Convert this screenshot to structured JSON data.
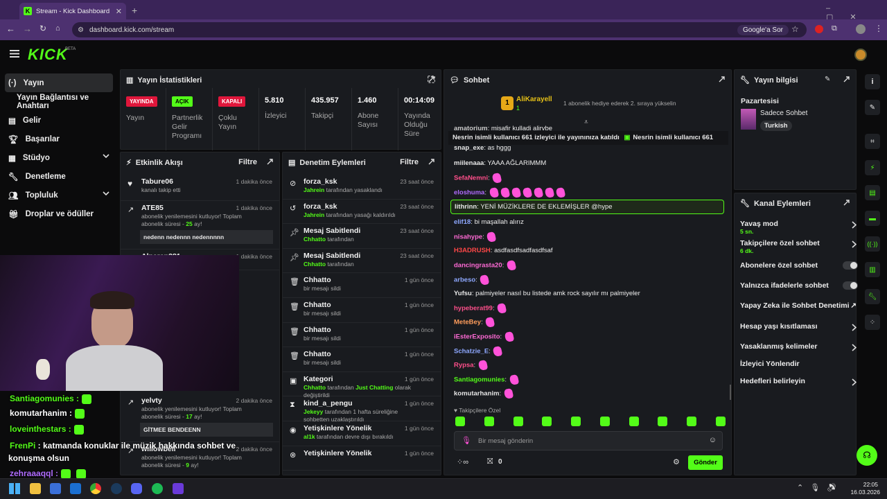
{
  "browser": {
    "tab_title": "Stream - Kick Dashboard",
    "url": "dashboard.kick.com/stream",
    "google_pill": "Google'a Sor"
  },
  "kick": {
    "logo": "KICK",
    "beta": "BETA"
  },
  "sidebar": {
    "items": [
      {
        "label": "Yayın",
        "icon": "broadcast-icon"
      },
      {
        "label": "Yayın Bağlantısı ve Anahtarı"
      },
      {
        "label": "Gelir",
        "icon": "chart-icon"
      },
      {
        "label": "Başarılar",
        "icon": "trophy-icon"
      },
      {
        "label": "Stüdyo",
        "icon": "studio-icon"
      },
      {
        "label": "Denetleme",
        "icon": "wrench-icon"
      },
      {
        "label": "Topluluk",
        "icon": "community-icon"
      },
      {
        "label": "Droplar ve ödüller",
        "icon": "gift-icon"
      }
    ]
  },
  "stats": {
    "title": "Yayın İstatistikleri",
    "items": [
      {
        "badge": "YAYINDA",
        "label": "Yayın",
        "color": "#e0163b"
      },
      {
        "badge": "AÇIK",
        "label": "Partnerlik Gelir Programı",
        "color": "#53fc18"
      },
      {
        "badge": "KAPALI",
        "label": "Çoklu Yayın",
        "color": "#e0163b"
      },
      {
        "value": "5.810",
        "label": "İzleyici"
      },
      {
        "value": "435.957",
        "label": "Takipçi"
      },
      {
        "value": "1.460",
        "label": "Abone Sayısı"
      },
      {
        "value": "00:14:09",
        "label": "Yayında Olduğu Süre"
      }
    ]
  },
  "activity": {
    "title": "Etkinlik Akışı",
    "filter": "Filtre",
    "rows": [
      {
        "user": "Tabure06",
        "text": "kanalı takip etti",
        "time": "1 dakika önce"
      },
      {
        "user": "ATE85",
        "text": "abonelik yenilemesini kutluyor! Toplam abonelik süresi - ",
        "months": "25",
        "suffix": " ay!",
        "time": "1 dakika önce",
        "msg": "nedenn nedennn nedennnnn"
      },
      {
        "user": "Alperen381",
        "time": "1 dakika önce"
      },
      {
        "user": "yelvty",
        "text": "abonelik yenilemesini kutluyor! Toplam abonelik süresi - ",
        "months": "17",
        "suffix": " ay!",
        "time": "2 dakika önce",
        "msg": "GİTMEE BENDEENN"
      },
      {
        "user": "willowbell",
        "text": "abonelik yenilemesini kutluyor! Toplam abonelik süresi - ",
        "months": "9",
        "suffix": " ay!",
        "time": "2 dakika önce"
      }
    ]
  },
  "moderation": {
    "title": "Denetim Eylemleri",
    "filter": "Filtre",
    "rows": [
      {
        "title": "forza_ksk",
        "actor": "Jahrein",
        "text": " tarafından yasaklandı",
        "time": "23 saat önce",
        "icon": "ban-icon"
      },
      {
        "title": "forza_ksk",
        "actor": "Jahrein",
        "text": " tarafından yasağı kaldırıldı",
        "time": "23 saat önce",
        "icon": "undo-icon"
      },
      {
        "title": "Mesaj Sabitlendi",
        "actor": "Chhatto",
        "text": " tarafından",
        "time": "23 saat önce",
        "icon": "pin-icon"
      },
      {
        "title": "Mesaj Sabitlendi",
        "actor": "Chhatto",
        "text": " tarafından",
        "time": "23 saat önce",
        "icon": "pin-icon"
      },
      {
        "title": "Chhatto",
        "actor": "",
        "text": "bir mesajı sildi",
        "time": "1 gün önce",
        "icon": "trash-icon"
      },
      {
        "title": "Chhatto",
        "actor": "",
        "text": "bir mesajı sildi",
        "time": "1 gün önce",
        "icon": "trash-icon"
      },
      {
        "title": "Chhatto",
        "actor": "",
        "text": "bir mesajı sildi",
        "time": "1 gün önce",
        "icon": "trash-icon"
      },
      {
        "title": "Chhatto",
        "actor": "",
        "text": "bir mesajı sildi",
        "time": "1 gün önce",
        "icon": "trash-icon"
      },
      {
        "title": "Kategori",
        "actor": "Chhatto",
        "text": " tarafından ",
        "extra": "Just Chatting",
        "text2": " olarak değiştirildi",
        "time": "1 gün önce",
        "icon": "category-icon"
      },
      {
        "title": "kind_a_pengu",
        "actor": "Jekeyy",
        "text": " tarafından 1 hafta süreliğine sohbetten uzaklaştırıldı",
        "time": "1 gün önce",
        "icon": "hourglass-icon"
      },
      {
        "title": "Yetişkinlere Yönelik",
        "actor": "al1k",
        "text": " tarafından devre dışı bırakıldı",
        "time": "1 gün önce",
        "icon": "eye-icon"
      },
      {
        "title": "Yetişkinlere Yönelik",
        "actor": "",
        "text": "",
        "time": "1 gün önce",
        "icon": "eye-off-icon"
      }
    ]
  },
  "chat": {
    "title": "Sohbet",
    "top_gifter": "AliKarayell",
    "top_gifter_count": "1",
    "gift_hint": "1 abonelik hediye ederek 2. sıraya yükselin",
    "ticker": [
      "Nesrin isimli kullanıcı ",
      "661",
      " izleyici ile yayınınıza katıldı",
      "Nesrin isimli kullanıcı ",
      "661"
    ],
    "lines": [
      {
        "user": "amatorium",
        "color": "#c8c8c8",
        "text": "misafir kulladi alirvbe"
      },
      {
        "user": "snap_exe",
        "color": "#e8e8e8",
        "text": "as hggg"
      },
      {
        "user": "miilenaaa",
        "color": "#e8e8e8",
        "text": "YAAA AĞLARIMMM"
      },
      {
        "user": "SefaNemni",
        "color": "#ff4f8b",
        "text": ""
      },
      {
        "user": "eloshuma",
        "color": "#b06cff",
        "text": ""
      },
      {
        "user": "lithrinn",
        "color": "#e8e8e8",
        "text": "YENİ MÜZİKLERE DE EKLEMİŞLER @hype"
      },
      {
        "user": "elif18",
        "color": "#8ea8ff",
        "text": "bi maşallah alırız"
      },
      {
        "user": "nisahype",
        "color": "#ff6ad5",
        "text": ""
      },
      {
        "user": "H3ADRUSH",
        "color": "#ff4747",
        "text": "asdfasdfsadfasdfsaf"
      },
      {
        "user": "dancingrasta20",
        "color": "#ff6ad5",
        "text": ""
      },
      {
        "user": "arbeso",
        "color": "#8ea8ff",
        "text": ""
      },
      {
        "user": "Yufsu",
        "color": "#e8e8e8",
        "text": "palmiyeler nasıl bu listede amk rock sayılır mı palmiyeler"
      },
      {
        "user": "hypeberat99",
        "color": "#ff4f8b",
        "text": ""
      },
      {
        "user": "MeteBey",
        "color": "#ff9d5c",
        "text": ""
      },
      {
        "user": "iEsterExposito",
        "color": "#ff6ad5",
        "text": ""
      },
      {
        "user": "Schatzie_E",
        "color": "#8ea8ff",
        "text": ""
      },
      {
        "user": "Rypsa",
        "color": "#ff4f8b",
        "text": ""
      },
      {
        "user": "Santiagomunies",
        "color": "#53fc18",
        "text": ""
      },
      {
        "user": "komutarhanim",
        "color": "#e8e8e8",
        "text": ""
      }
    ],
    "followers_only": "Takipçilere Özel",
    "input_placeholder": "Bir mesaj gönderin",
    "points": "0",
    "send": "Gönder"
  },
  "info": {
    "title": "Yayın bilgisi",
    "day": "Pazartesisi",
    "stream_title": "Sadece Sohbet",
    "tag": "Turkish"
  },
  "channel": {
    "title": "Kanal Eylemleri",
    "items": [
      {
        "label": "Yavaş mod",
        "sub": "5 sn.",
        "type": "chevron"
      },
      {
        "label": "Takipçilere özel sohbet",
        "sub": "6 dk.",
        "type": "chevron"
      },
      {
        "label": "Abonelere özel sohbet",
        "type": "toggle"
      },
      {
        "label": "Yalnızca ifadelerle sohbet",
        "type": "toggle"
      },
      {
        "label": "Yapay Zeka ile Sohbet Denetimi",
        "type": "external"
      },
      {
        "label": "Hesap yaşı kısıtlaması",
        "type": "chevron"
      },
      {
        "label": "Yasaklanmış kelimeler",
        "type": "chevron"
      },
      {
        "label": "İzleyici Yönlendir",
        "type": "none"
      },
      {
        "label": "Hedefleri belirleyin",
        "type": "chevron"
      }
    ]
  },
  "overlay": {
    "lines": [
      {
        "user": "Santiagomunies :",
        "color": "#53fc18"
      },
      {
        "user": "komutarhanim :",
        "color": "#fff"
      },
      {
        "user": "loveinthestars :",
        "color": "#53fc18"
      },
      {
        "user": "FrenPi",
        "color": "#53fc18",
        "text": " : katmanda konuklar ile müzik hakkında sohbet ve"
      },
      {
        "user": "",
        "text": "konuşma olsun",
        "color": "#fff"
      },
      {
        "user": "zehraaaqql :",
        "color": "#b06cff"
      }
    ]
  },
  "taskbar": {
    "time": "22:05",
    "date": "16.03.2026"
  }
}
